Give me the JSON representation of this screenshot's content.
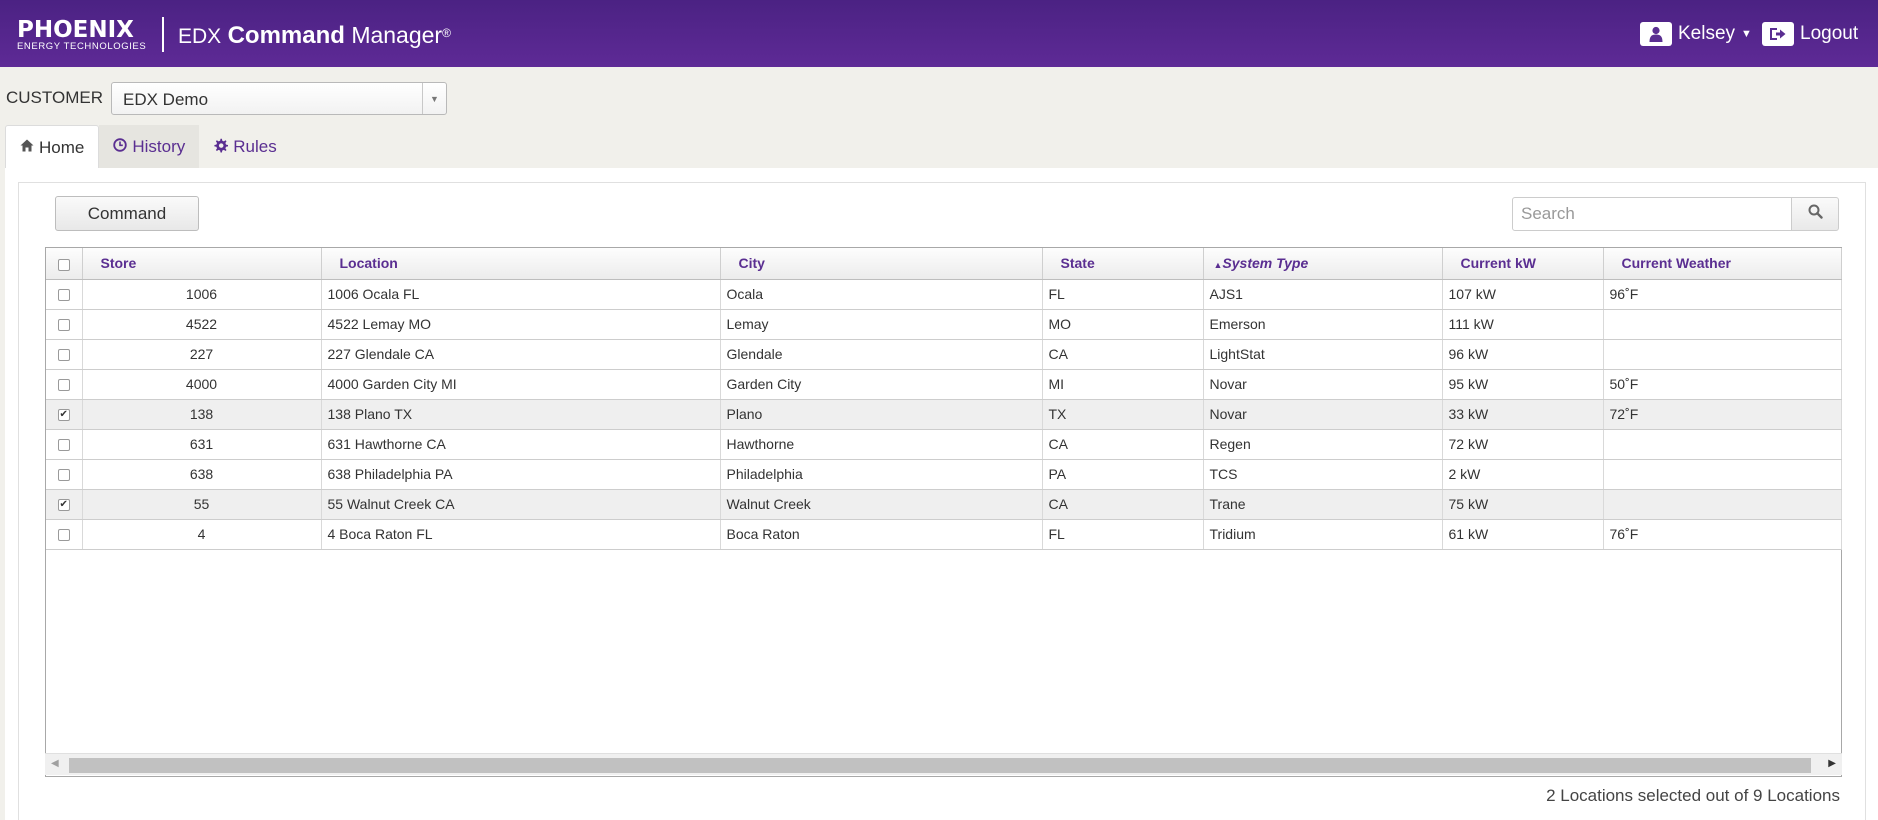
{
  "header": {
    "logo_main": "PHOENIX",
    "logo_sub": "ENERGY TECHNOLOGIES",
    "app_title_prefix": "EDX",
    "app_title_main": "Command",
    "app_title_suffix": "Manager",
    "app_title_mark": "®",
    "user_name": "Kelsey",
    "logout_label": "Logout"
  },
  "customer": {
    "label": "CUSTOMER",
    "selected": "EDX Demo"
  },
  "tabs": [
    {
      "label": "Home",
      "icon": "home-icon"
    },
    {
      "label": "History",
      "icon": "clock-icon"
    },
    {
      "label": "Rules",
      "icon": "gear-icon"
    }
  ],
  "toolbar": {
    "command_label": "Command",
    "search_placeholder": "Search"
  },
  "grid": {
    "columns": [
      "Store",
      "Location",
      "City",
      "State",
      "System Type",
      "Current kW",
      "Current Weather"
    ],
    "rows": [
      {
        "checked": false,
        "store": "1006",
        "location": "1006 Ocala FL",
        "city": "Ocala",
        "state": "FL",
        "system": "AJS1",
        "kw": "107 kW",
        "weather": "96˚F"
      },
      {
        "checked": false,
        "store": "4522",
        "location": "4522 Lemay MO",
        "city": "Lemay",
        "state": "MO",
        "system": "Emerson",
        "kw": "111 kW",
        "weather": ""
      },
      {
        "checked": false,
        "store": "227",
        "location": "227 Glendale CA",
        "city": "Glendale",
        "state": "CA",
        "system": "LightStat",
        "kw": "96 kW",
        "weather": ""
      },
      {
        "checked": false,
        "store": "4000",
        "location": "4000 Garden City MI",
        "city": "Garden City",
        "state": "MI",
        "system": "Novar",
        "kw": "95 kW",
        "weather": "50˚F"
      },
      {
        "checked": true,
        "store": "138",
        "location": "138 Plano TX",
        "city": "Plano",
        "state": "TX",
        "system": "Novar",
        "kw": "33 kW",
        "weather": "72˚F"
      },
      {
        "checked": false,
        "store": "631",
        "location": "631 Hawthorne CA",
        "city": "Hawthorne",
        "state": "CA",
        "system": "Regen",
        "kw": "72 kW",
        "weather": ""
      },
      {
        "checked": false,
        "store": "638",
        "location": "638 Philadelphia PA",
        "city": "Philadelphia",
        "state": "PA",
        "system": "TCS",
        "kw": "2 kW",
        "weather": ""
      },
      {
        "checked": true,
        "store": "55",
        "location": "55 Walnut Creek CA",
        "city": "Walnut Creek",
        "state": "CA",
        "system": "Trane",
        "kw": "75 kW",
        "weather": ""
      },
      {
        "checked": false,
        "store": "4",
        "location": "4 Boca Raton FL",
        "city": "Boca Raton",
        "state": "FL",
        "system": "Tridium",
        "kw": "61 kW",
        "weather": "76˚F"
      }
    ]
  },
  "status": {
    "selection_text": "2 Locations selected out of 9 Locations"
  },
  "colors": {
    "brand_purple": "#5a2e91",
    "header_gradient_top": "#4b2283",
    "header_gradient_bottom": "#5e2a96"
  }
}
